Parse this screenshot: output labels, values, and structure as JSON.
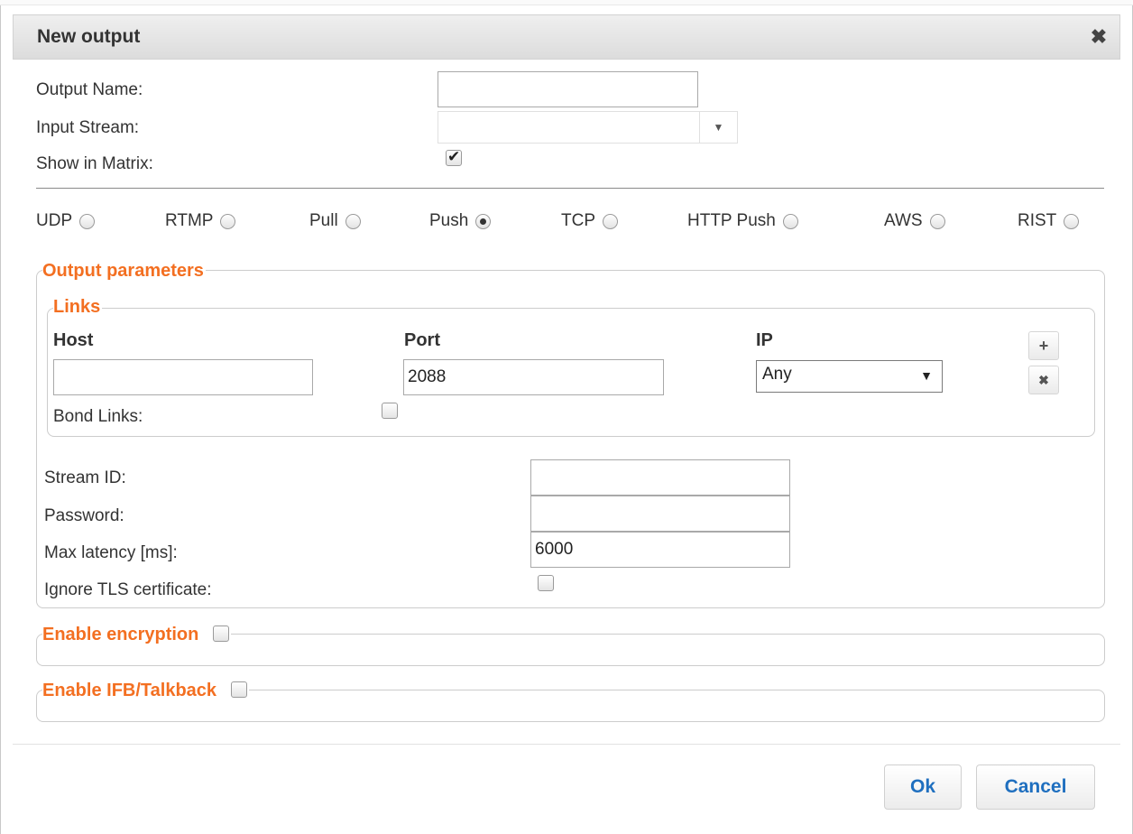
{
  "dialog": {
    "title": "New output",
    "close_icon": "close-icon"
  },
  "form": {
    "output_name_label": "Output Name:",
    "output_name_value": "",
    "input_stream_label": "Input Stream:",
    "input_stream_value": "",
    "show_in_matrix_label": "Show in Matrix:",
    "show_in_matrix_checked": true
  },
  "protocols": [
    {
      "label": "UDP",
      "selected": false
    },
    {
      "label": "RTMP",
      "selected": false
    },
    {
      "label": "Pull",
      "selected": false
    },
    {
      "label": "Push",
      "selected": true
    },
    {
      "label": "TCP",
      "selected": false
    },
    {
      "label": "HTTP Push",
      "selected": false
    },
    {
      "label": "AWS",
      "selected": false
    },
    {
      "label": "RIST",
      "selected": false
    }
  ],
  "output_parameters": {
    "legend": "Output parameters",
    "links": {
      "legend": "Links",
      "host_header": "Host",
      "port_header": "Port",
      "ip_header": "IP",
      "host_value": "",
      "port_value": "2088",
      "ip_value": "Any",
      "add_icon": "plus-icon",
      "remove_icon": "close-icon",
      "bond_links_label": "Bond Links:",
      "bond_links_checked": false
    },
    "stream_id_label": "Stream ID:",
    "stream_id_value": "",
    "password_label": "Password:",
    "password_value": "",
    "max_latency_label": "Max latency [ms]:",
    "max_latency_value": "6000",
    "ignore_tls_label": "Ignore TLS certificate:",
    "ignore_tls_checked": false
  },
  "enable_encryption": {
    "label": "Enable encryption",
    "checked": false
  },
  "enable_ifb": {
    "label": "Enable IFB/Talkback",
    "checked": false
  },
  "buttons": {
    "ok": "Ok",
    "cancel": "Cancel"
  },
  "colors": {
    "accent": "#f36f21",
    "button_text": "#1f6fbf"
  }
}
